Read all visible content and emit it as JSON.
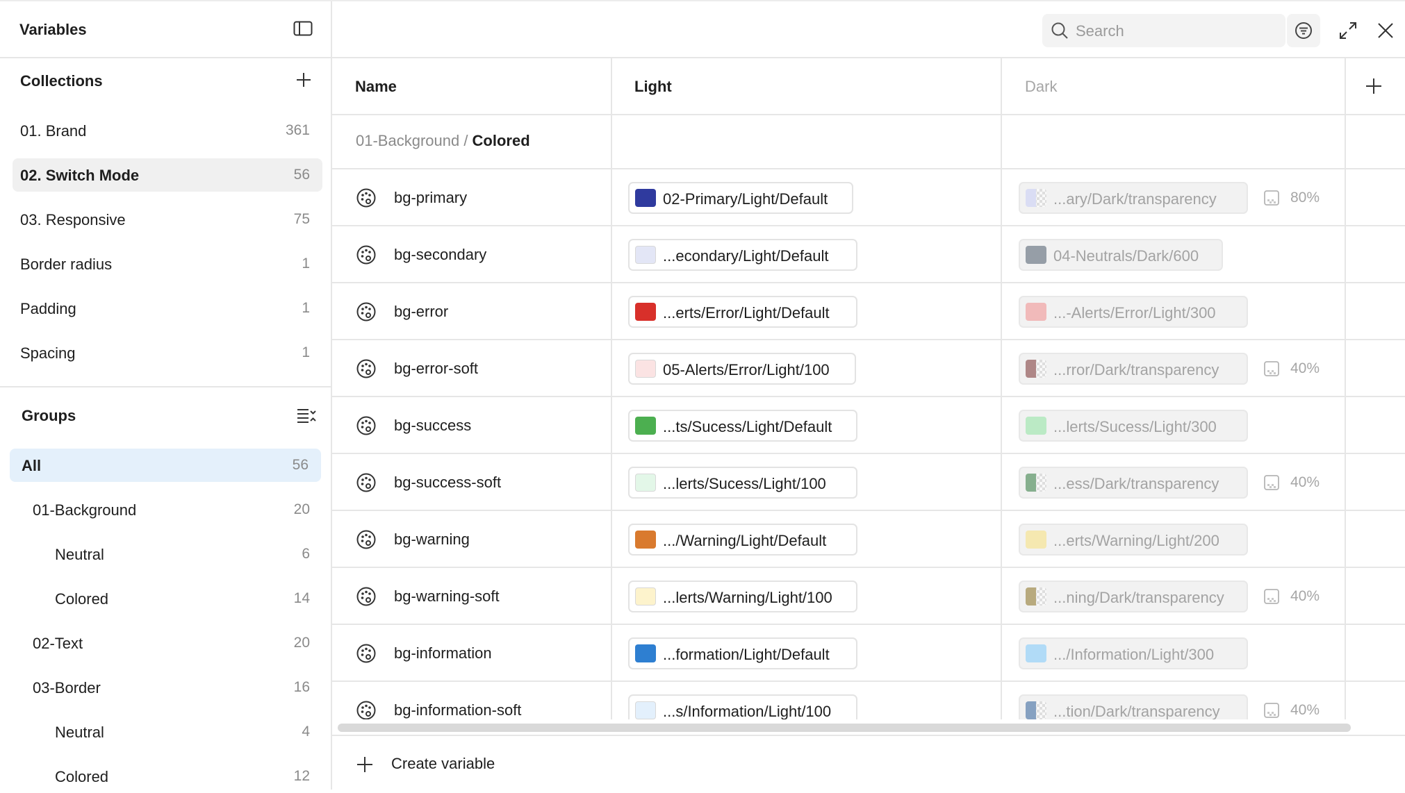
{
  "panel": {
    "title": "Variables"
  },
  "collections": {
    "title": "Collections",
    "items": [
      {
        "label": "01. Brand",
        "count": "361"
      },
      {
        "label": "02. Switch Mode",
        "count": "56"
      },
      {
        "label": "03. Responsive",
        "count": "75"
      },
      {
        "label": "Border radius",
        "count": "1"
      },
      {
        "label": "Padding",
        "count": "1"
      },
      {
        "label": "Spacing",
        "count": "1"
      }
    ]
  },
  "groups": {
    "title": "Groups",
    "items": [
      {
        "label": "All",
        "count": "56"
      },
      {
        "label": "01-Background",
        "count": "20"
      },
      {
        "label": "Neutral",
        "count": "6"
      },
      {
        "label": "Colored",
        "count": "14"
      },
      {
        "label": "02-Text",
        "count": "20"
      },
      {
        "label": "03-Border",
        "count": "16"
      },
      {
        "label": "Neutral",
        "count": "4"
      },
      {
        "label": "Colored",
        "count": "12"
      }
    ]
  },
  "search": {
    "placeholder": "Search"
  },
  "table": {
    "columns": {
      "name": "Name",
      "light": "Light",
      "dark": "Dark"
    },
    "breadcrumb": {
      "parent": "01-Background / ",
      "current": "Colored"
    },
    "rows": [
      {
        "name": "bg-primary",
        "light": {
          "color": "#2f3a9e",
          "text": "02-Primary/Light/Default"
        },
        "dark": {
          "color": "#c8ccf7",
          "text": "...ary/Dark/transparency",
          "alpha": "80%"
        }
      },
      {
        "name": "bg-secondary",
        "light": {
          "color": "#e3e6f6",
          "text": "...econdary/Light/Default"
        },
        "dark": {
          "color": "#4b5a6a",
          "text": "04-Neutrals/Dark/600"
        }
      },
      {
        "name": "bg-error",
        "light": {
          "color": "#d8302a",
          "text": "...erts/Error/Light/Default"
        },
        "dark": {
          "color": "#f08c8c",
          "text": "...-Alerts/Error/Light/300"
        }
      },
      {
        "name": "bg-error-soft",
        "light": {
          "color": "#fbe3e3",
          "text": "05-Alerts/Error/Light/100"
        },
        "dark": {
          "color": "#7a3030",
          "text": "...rror/Dark/transparency",
          "alpha": "40%"
        }
      },
      {
        "name": "bg-success",
        "light": {
          "color": "#4caf50",
          "text": "...ts/Sucess/Light/Default"
        },
        "dark": {
          "color": "#8ee3a0",
          "text": "...lerts/Sucess/Light/300"
        }
      },
      {
        "name": "bg-success-soft",
        "light": {
          "color": "#e3f7e8",
          "text": "...lerts/Sucess/Light/100"
        },
        "dark": {
          "color": "#2f7a3d",
          "text": "...ess/Dark/transparency",
          "alpha": "40%"
        }
      },
      {
        "name": "bg-warning",
        "light": {
          "color": "#d97a2e",
          "text": ".../Warning/Light/Default"
        },
        "dark": {
          "color": "#f7e07a",
          "text": "...erts/Warning/Light/200"
        }
      },
      {
        "name": "bg-warning-soft",
        "light": {
          "color": "#fdf3cc",
          "text": "...lerts/Warning/Light/100"
        },
        "dark": {
          "color": "#8a7020",
          "text": "...ning/Dark/transparency",
          "alpha": "40%"
        }
      },
      {
        "name": "bg-information",
        "light": {
          "color": "#2e7fd1",
          "text": "...formation/Light/Default"
        },
        "dark": {
          "color": "#7cc8fb",
          "text": ".../Information/Light/300"
        }
      },
      {
        "name": "bg-information-soft",
        "light": {
          "color": "#e3f0fc",
          "text": "...s/Information/Light/100"
        },
        "dark": {
          "color": "#2e5f9a",
          "text": "...tion/Dark/transparency",
          "alpha": "40%"
        }
      }
    ]
  },
  "footer": {
    "create_label": "Create variable"
  },
  "icons": {
    "panel": "sidebar-toggle-icon",
    "add": "plus-icon",
    "groups": "sort-list-icon",
    "search": "search-icon",
    "filter": "filter-icon",
    "expand": "expand-icon",
    "close": "close-icon",
    "row": "palette-icon",
    "alpha": "opacity-icon"
  }
}
